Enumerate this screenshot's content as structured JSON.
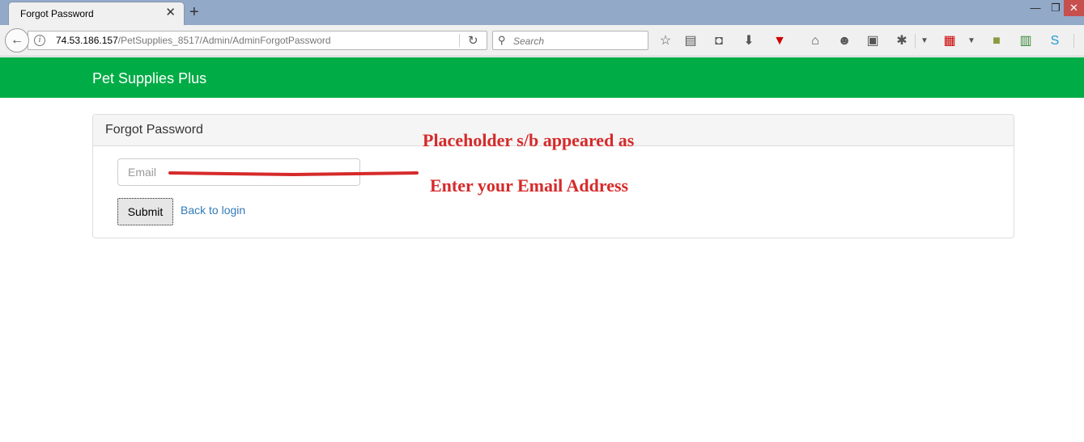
{
  "browser": {
    "tab_title": "Forgot Password",
    "tab_close_glyph": "✕",
    "new_tab_glyph": "+",
    "window": {
      "minimize": "—",
      "restore": "❐",
      "close": "✕"
    },
    "url_host": "74.53.186.157",
    "url_path": "/PetSupplies_8517/Admin/AdminForgotPassword",
    "search_placeholder": "Search",
    "toolbar_icons": [
      "bookmark-star-icon",
      "reading-list-icon",
      "pocket-icon",
      "download-icon",
      "flash-icon",
      "home-icon",
      "emoji-icon",
      "screenshot-icon",
      "bug-icon",
      "new-tab-page-icon",
      "extension-icon",
      "spreadsheet-icon",
      "skype-icon"
    ]
  },
  "app": {
    "brand": "Pet Supplies Plus",
    "brand_color": "#00ac46"
  },
  "panel": {
    "title": "Forgot Password",
    "email_placeholder": "Email",
    "submit_label": "Submit",
    "back_link": "Back to login",
    "link_color": "#337ab7"
  },
  "annotation": {
    "line1": "Placeholder s/b appeared as",
    "line2": "Enter your Email Address",
    "color": "#d62a2a"
  }
}
